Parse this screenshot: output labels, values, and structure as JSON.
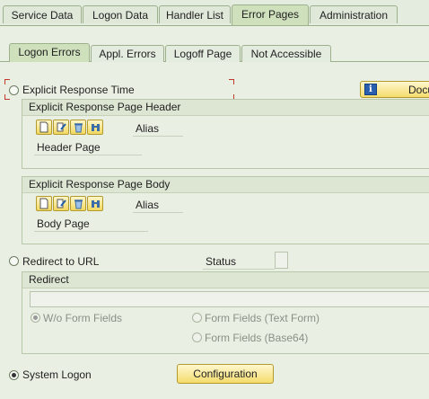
{
  "main_tabs": [
    {
      "label": "Service Data"
    },
    {
      "label": "Logon Data"
    },
    {
      "label": "Handler List"
    },
    {
      "label": "Error Pages"
    },
    {
      "label": "Administration"
    }
  ],
  "sub_tabs": [
    {
      "label": "Logon Errors"
    },
    {
      "label": "Appl. Errors"
    },
    {
      "label": "Logoff Page"
    },
    {
      "label": "Not Accessible"
    }
  ],
  "explicit_response": {
    "radio_label": "Explicit Response Time",
    "doc_button_label": "Docu",
    "header_group": {
      "title": "Explicit Response Page Header",
      "alias_label": "Alias",
      "page_label": "Header Page",
      "icons": [
        "new-document-icon",
        "edit-icon",
        "delete-icon",
        "binoculars-icon"
      ]
    },
    "body_group": {
      "title": "Explicit Response Page Body",
      "alias_label": "Alias",
      "page_label": "Body Page",
      "icons": [
        "new-document-icon",
        "edit-icon",
        "delete-icon",
        "binoculars-icon"
      ]
    }
  },
  "redirect": {
    "radio_label": "Redirect to URL",
    "status_label": "Status",
    "group_title": "Redirect",
    "url_value": "",
    "options": [
      {
        "label": "W/o Form Fields",
        "checked": true
      },
      {
        "label": "Form Fields (Text Form)",
        "checked": false
      },
      {
        "label": "Form Fields (Base64)",
        "checked": false
      }
    ]
  },
  "system_logon": {
    "radio_label": "System Logon",
    "checked": true,
    "config_button_label": "Configuration"
  }
}
